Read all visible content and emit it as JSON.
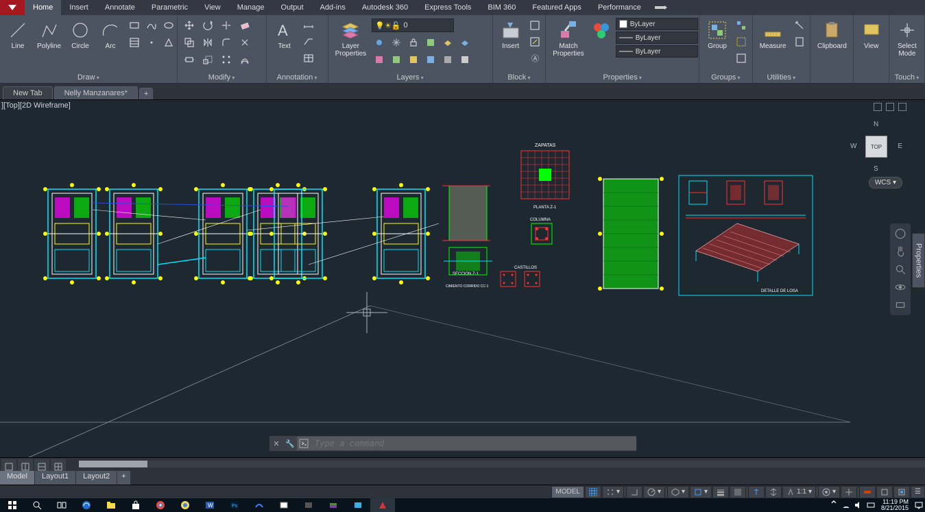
{
  "ribbon": {
    "tabs": [
      "Home",
      "Insert",
      "Annotate",
      "Parametric",
      "View",
      "Manage",
      "Output",
      "Add-ins",
      "Autodesk 360",
      "Express Tools",
      "BIM 360",
      "Featured Apps",
      "Performance"
    ],
    "active_tab": "Home",
    "panels": {
      "draw": {
        "title": "Draw",
        "line": "Line",
        "polyline": "Polyline",
        "circle": "Circle",
        "arc": "Arc"
      },
      "modify": {
        "title": "Modify"
      },
      "annotation": {
        "title": "Annotation",
        "text": "Text"
      },
      "layers": {
        "title": "Layers",
        "props": "Layer\nProperties",
        "current": "0"
      },
      "block": {
        "title": "Block",
        "insert": "Insert"
      },
      "properties": {
        "title": "Properties",
        "match": "Match\nProperties",
        "color": "ByLayer",
        "lw": "ByLayer",
        "lt": "ByLayer"
      },
      "groups": {
        "title": "Groups",
        "group": "Group"
      },
      "utilities": {
        "title": "Utilities",
        "measure": "Measure"
      },
      "clipboard": {
        "title": "Clipboard",
        "label": "Clipboard"
      },
      "view": {
        "title": "View",
        "label": "View"
      },
      "touch": {
        "title": "Touch",
        "label": "Select\nMode"
      }
    }
  },
  "file_tabs": {
    "new_tab": "New Tab",
    "doc": "Nelly Manzanares*",
    "plus": "+"
  },
  "viewport": {
    "label": "][Top][2D Wireframe]",
    "cube": "TOP",
    "n": "N",
    "e": "E",
    "s": "S",
    "w": "W",
    "wcs": "WCS ▾",
    "props_panel": "Properties"
  },
  "drawing_labels": {
    "zapatas": "ZAPATAS",
    "seccion": "SECCION Z-1",
    "planta": "PLANTA  Z-1",
    "cimiento": "CIMIENTO CORRIDO CC-1",
    "columna": "COLUMNA",
    "castillos": "CASTILLOS",
    "detalle": "DETALLE DE LOSA"
  },
  "cmd": {
    "placeholder": "Type a command"
  },
  "layout_tabs": {
    "model": "Model",
    "l1": "Layout1",
    "l2": "Layout2",
    "plus": "+"
  },
  "status": {
    "model": "MODEL",
    "scale": "1:1"
  },
  "taskbar": {
    "time": "11:19 PM",
    "date": "8/21/2015"
  }
}
